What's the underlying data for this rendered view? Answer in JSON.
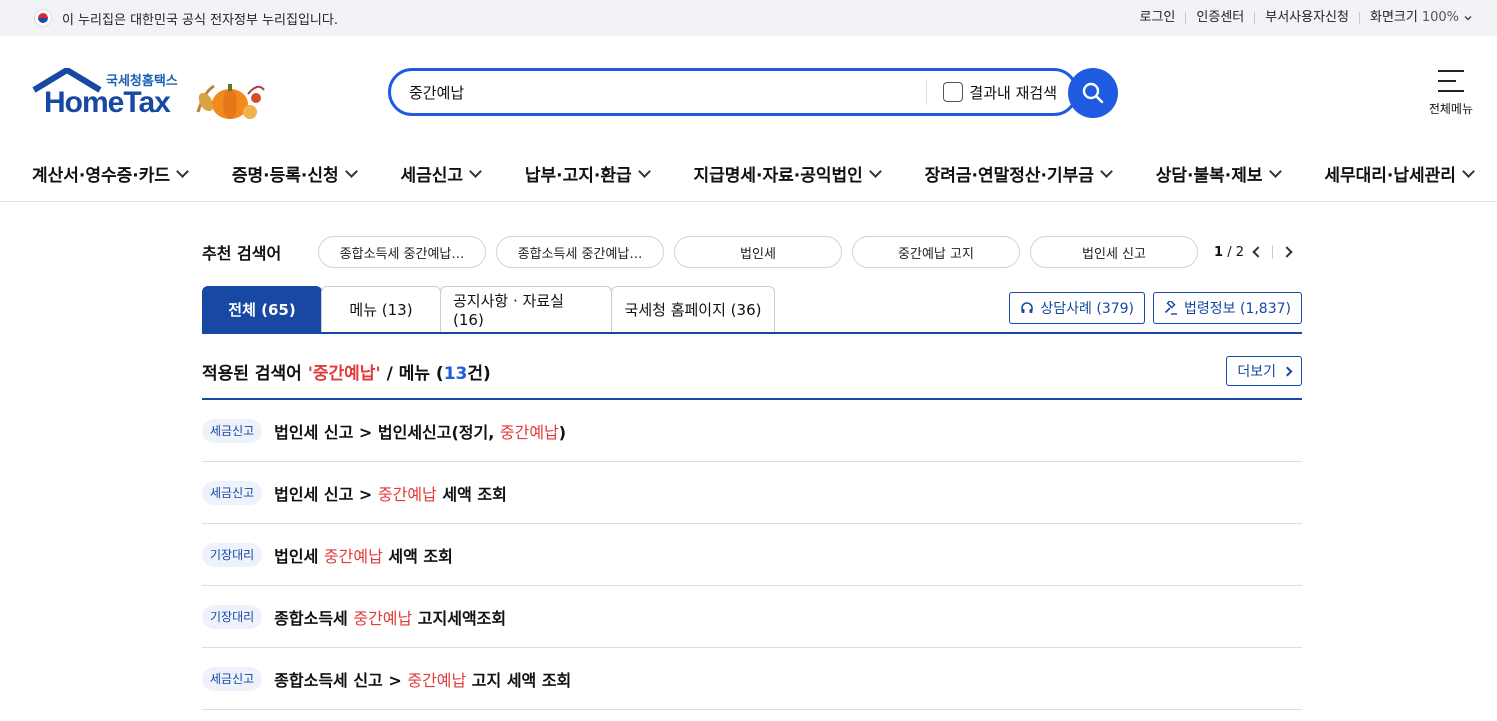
{
  "govbar": {
    "notice": "이 누리집은 대한민국 공식 전자정부 누리집입니다.",
    "links": [
      "로그인",
      "인증센터",
      "부서사용자신청"
    ],
    "zoom_label": "화면크기",
    "zoom_value": "100%"
  },
  "logo": {
    "sub": "국세청홈택스",
    "main": "HomeTax"
  },
  "search": {
    "value": "중간예납",
    "recheck_label": "결과내 재검색"
  },
  "allmenu_label": "전체메뉴",
  "gnb": [
    "계산서·영수증·카드",
    "증명·등록·신청",
    "세금신고",
    "납부·고지·환급",
    "지급명세·자료·공익법인",
    "장려금·연말정산·기부금",
    "상담·불복·제보",
    "세무대리·납세관리"
  ],
  "recommend": {
    "title": "추천 검색어",
    "chips": [
      "종합소득세 중간예납…",
      "종합소득세 중간예납…",
      "법인세",
      "중간예납 고지",
      "법인세 신고"
    ],
    "page_current": "1",
    "page_total": "/ 2"
  },
  "tabs": [
    "전체 (65)",
    "메뉴 (13)",
    "공지사항 · 자료실 (16)",
    "국세청 홈페이지 (36)"
  ],
  "ext_buttons": [
    "상담사례 (379)",
    "법령정보 (1,837)"
  ],
  "result": {
    "prefix": "적용된 검색어 ",
    "keyword": "'중간예납'",
    "mid": " / 메뉴 (",
    "count": "13",
    "suffix": "건)",
    "more_label": "더보기"
  },
  "rows": [
    {
      "badge": "세금신고",
      "pre": "법인세 신고 > 법인세신고(정기, ",
      "hl": "중간예납",
      "post": ")"
    },
    {
      "badge": "세금신고",
      "pre": "법인세 신고 > ",
      "hl": "중간예납",
      "post": " 세액 조회"
    },
    {
      "badge": "기장대리",
      "pre": "법인세 ",
      "hl": "중간예납",
      "post": " 세액 조회"
    },
    {
      "badge": "기장대리",
      "pre": "종합소득세 ",
      "hl": "중간예납",
      "post": " 고지세액조회"
    },
    {
      "badge": "세금신고",
      "pre": "종합소득세 신고 > ",
      "hl": "중간예납",
      "post": " 고지 세액 조회"
    }
  ]
}
